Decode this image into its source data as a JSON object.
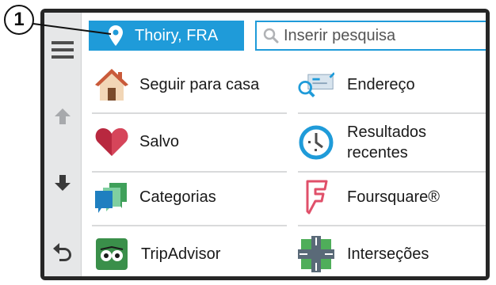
{
  "callout": {
    "number": "1"
  },
  "location": {
    "label": "Thoiry, FRA",
    "icon": "map-pin-icon"
  },
  "search": {
    "placeholder": "Inserir pesquisa",
    "icon": "search-icon"
  },
  "sidebar": {
    "items": [
      {
        "name": "menu",
        "icon": "hamburger-menu-icon"
      },
      {
        "name": "scroll-up",
        "icon": "arrow-up-icon"
      },
      {
        "name": "scroll-down",
        "icon": "arrow-down-icon"
      },
      {
        "name": "back",
        "icon": "back-arrow-icon"
      }
    ]
  },
  "menu": {
    "items": [
      {
        "label": "Seguir para casa",
        "icon": "house-icon"
      },
      {
        "label": "Endereço",
        "icon": "address-card-icon"
      },
      {
        "label": "Salvo",
        "icon": "heart-icon"
      },
      {
        "label": "Resultados\nrecentes",
        "icon": "clock-icon"
      },
      {
        "label": "Categorias",
        "icon": "categories-icon"
      },
      {
        "label": "Foursquare®",
        "icon": "foursquare-icon"
      },
      {
        "label": "TripAdvisor",
        "icon": "tripadvisor-icon"
      },
      {
        "label": "Interseções",
        "icon": "intersection-icon"
      }
    ]
  },
  "colors": {
    "accent": "#1f9bd9",
    "sidebar_bg": "#e6e7e8",
    "frame": "#262626"
  }
}
